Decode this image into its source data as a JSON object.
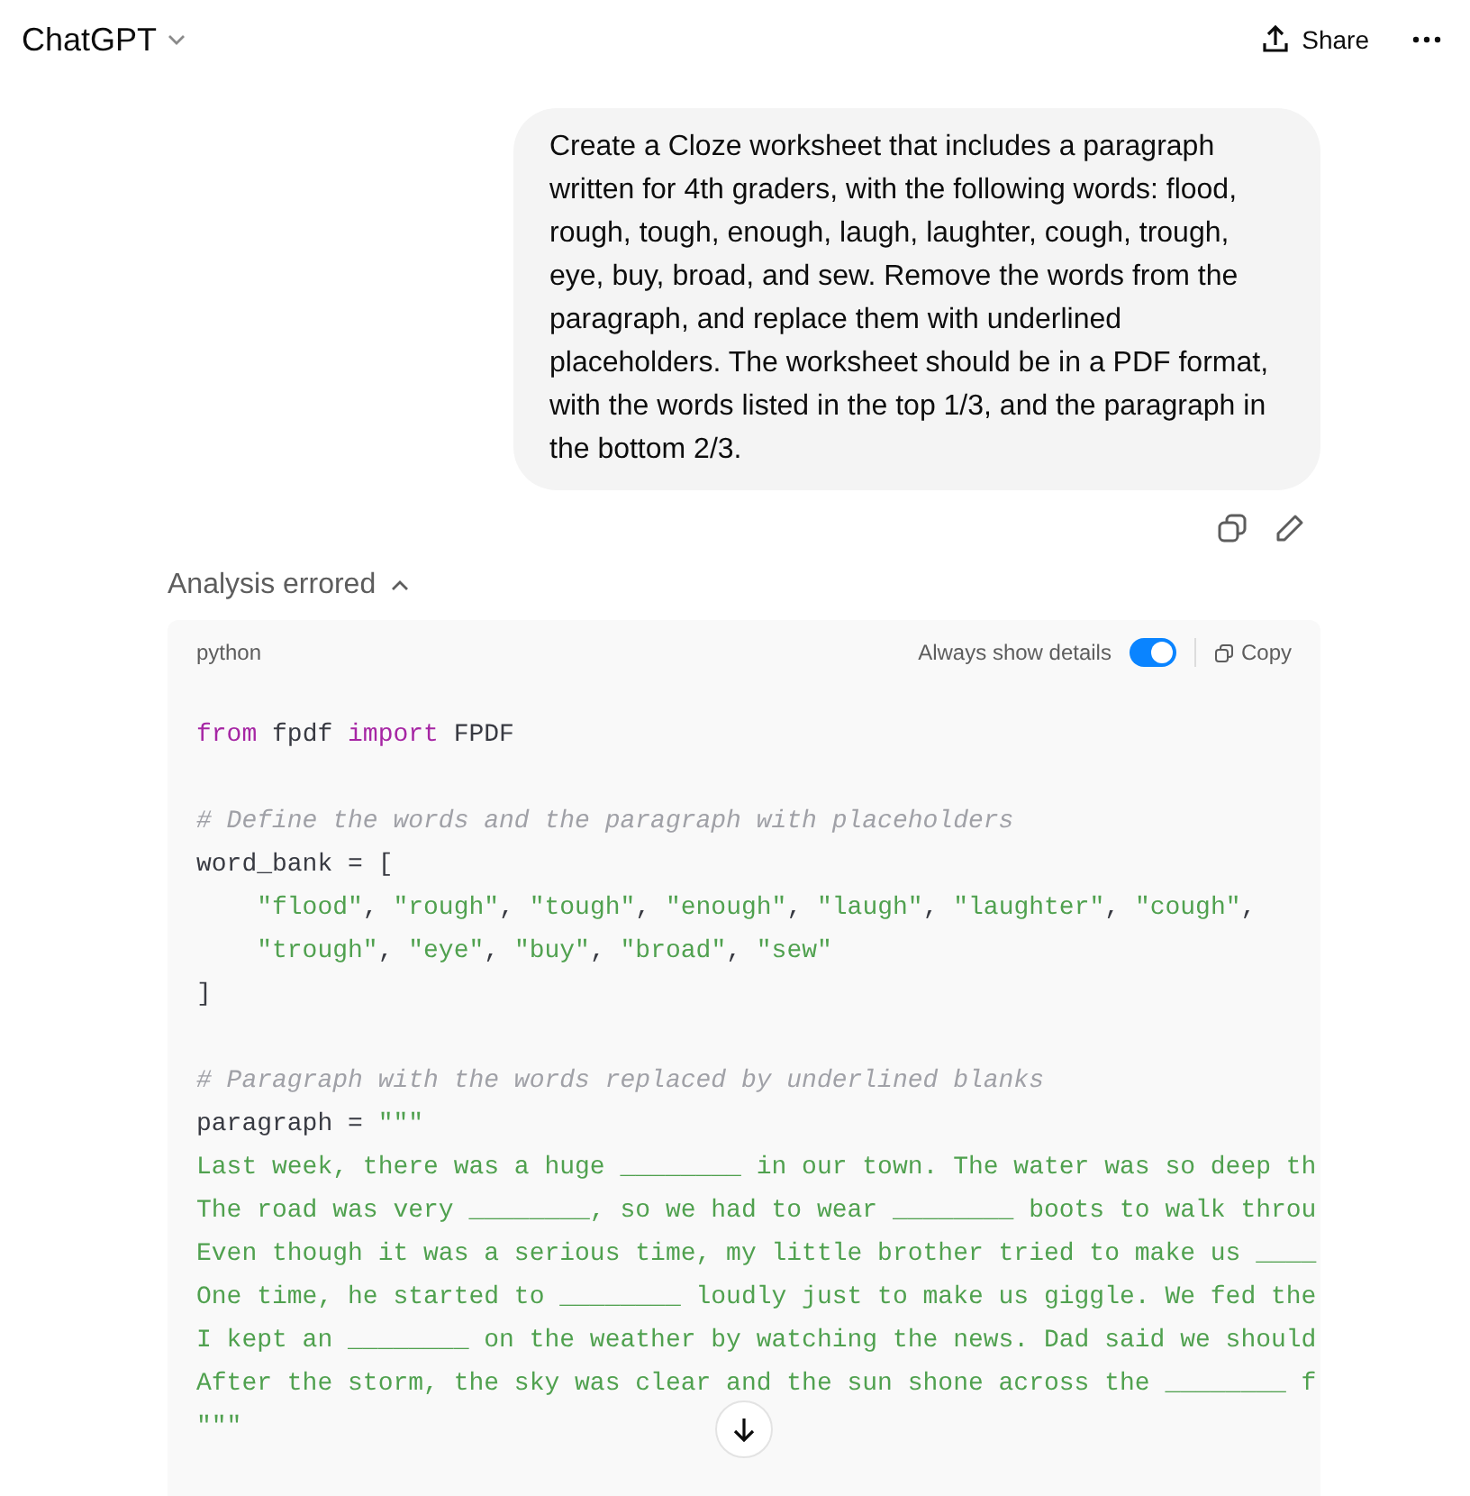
{
  "header": {
    "title": "ChatGPT",
    "share_label": "Share"
  },
  "user_message": {
    "text": "Create a Cloze worksheet that includes a paragraph written for 4th graders, with the following words: flood, rough, tough, enough, laugh, laughter, cough, trough, eye, buy, broad, and sew. Remove the words from the paragraph, and replace them with underlined placeholders. The worksheet should be in a PDF format, with the words listed in the top 1/3, and the paragraph in the bottom 2/3."
  },
  "analysis": {
    "status": "Analysis errored",
    "expanded": true
  },
  "code_block": {
    "language": "python",
    "toggle": {
      "label": "Always show details",
      "on": true
    },
    "copy_label": "Copy",
    "lines": [
      {
        "kind": "code",
        "tokens": [
          {
            "kind": "keyword",
            "text": "from"
          },
          {
            "kind": "plain",
            "text": " fpdf "
          },
          {
            "kind": "keyword",
            "text": "import"
          },
          {
            "kind": "plain",
            "text": " FPDF"
          }
        ]
      },
      {
        "kind": "blank"
      },
      {
        "kind": "code",
        "tokens": [
          {
            "kind": "comment",
            "text": "# Define the words and the paragraph with placeholders"
          }
        ]
      },
      {
        "kind": "code",
        "tokens": [
          {
            "kind": "plain",
            "text": "word_bank = ["
          }
        ]
      },
      {
        "kind": "code",
        "indented": true,
        "tokens": [
          {
            "kind": "string",
            "text": "\"flood\""
          },
          {
            "kind": "plain",
            "text": ", "
          },
          {
            "kind": "string",
            "text": "\"rough\""
          },
          {
            "kind": "plain",
            "text": ", "
          },
          {
            "kind": "string",
            "text": "\"tough\""
          },
          {
            "kind": "plain",
            "text": ", "
          },
          {
            "kind": "string",
            "text": "\"enough\""
          },
          {
            "kind": "plain",
            "text": ", "
          },
          {
            "kind": "string",
            "text": "\"laugh\""
          },
          {
            "kind": "plain",
            "text": ", "
          },
          {
            "kind": "string",
            "text": "\"laughter\""
          },
          {
            "kind": "plain",
            "text": ", "
          },
          {
            "kind": "string",
            "text": "\"cough\""
          },
          {
            "kind": "plain",
            "text": ","
          }
        ]
      },
      {
        "kind": "code",
        "indented": true,
        "tokens": [
          {
            "kind": "string",
            "text": "\"trough\""
          },
          {
            "kind": "plain",
            "text": ", "
          },
          {
            "kind": "string",
            "text": "\"eye\""
          },
          {
            "kind": "plain",
            "text": ", "
          },
          {
            "kind": "string",
            "text": "\"buy\""
          },
          {
            "kind": "plain",
            "text": ", "
          },
          {
            "kind": "string",
            "text": "\"broad\""
          },
          {
            "kind": "plain",
            "text": ", "
          },
          {
            "kind": "string",
            "text": "\"sew\""
          }
        ]
      },
      {
        "kind": "code",
        "tokens": [
          {
            "kind": "plain",
            "text": "]"
          }
        ]
      },
      {
        "kind": "blank"
      },
      {
        "kind": "code",
        "tokens": [
          {
            "kind": "comment",
            "text": "# Paragraph with the words replaced by underlined blanks"
          }
        ]
      },
      {
        "kind": "code",
        "tokens": [
          {
            "kind": "plain",
            "text": "paragraph = "
          },
          {
            "kind": "string",
            "text": "\"\"\""
          }
        ]
      },
      {
        "kind": "code",
        "tokens": [
          {
            "kind": "string",
            "text": "Last week, there was a huge ________ in our town. The water was so deep th"
          }
        ]
      },
      {
        "kind": "code",
        "tokens": [
          {
            "kind": "string",
            "text": "The road was very ________, so we had to wear ________ boots to walk throu"
          }
        ]
      },
      {
        "kind": "code",
        "tokens": [
          {
            "kind": "string",
            "text": "Even though it was a serious time, my little brother tried to make us ____"
          }
        ]
      },
      {
        "kind": "code",
        "tokens": [
          {
            "kind": "string",
            "text": "One time, he started to ________ loudly just to make us giggle. We fed the"
          }
        ]
      },
      {
        "kind": "code",
        "tokens": [
          {
            "kind": "string",
            "text": "I kept an ________ on the weather by watching the news. Dad said we should"
          }
        ]
      },
      {
        "kind": "code",
        "tokens": [
          {
            "kind": "string",
            "text": "After the storm, the sky was clear and the sun shone across the ________ f"
          }
        ]
      },
      {
        "kind": "code",
        "tokens": [
          {
            "kind": "string",
            "text": "\"\"\""
          }
        ]
      }
    ]
  }
}
